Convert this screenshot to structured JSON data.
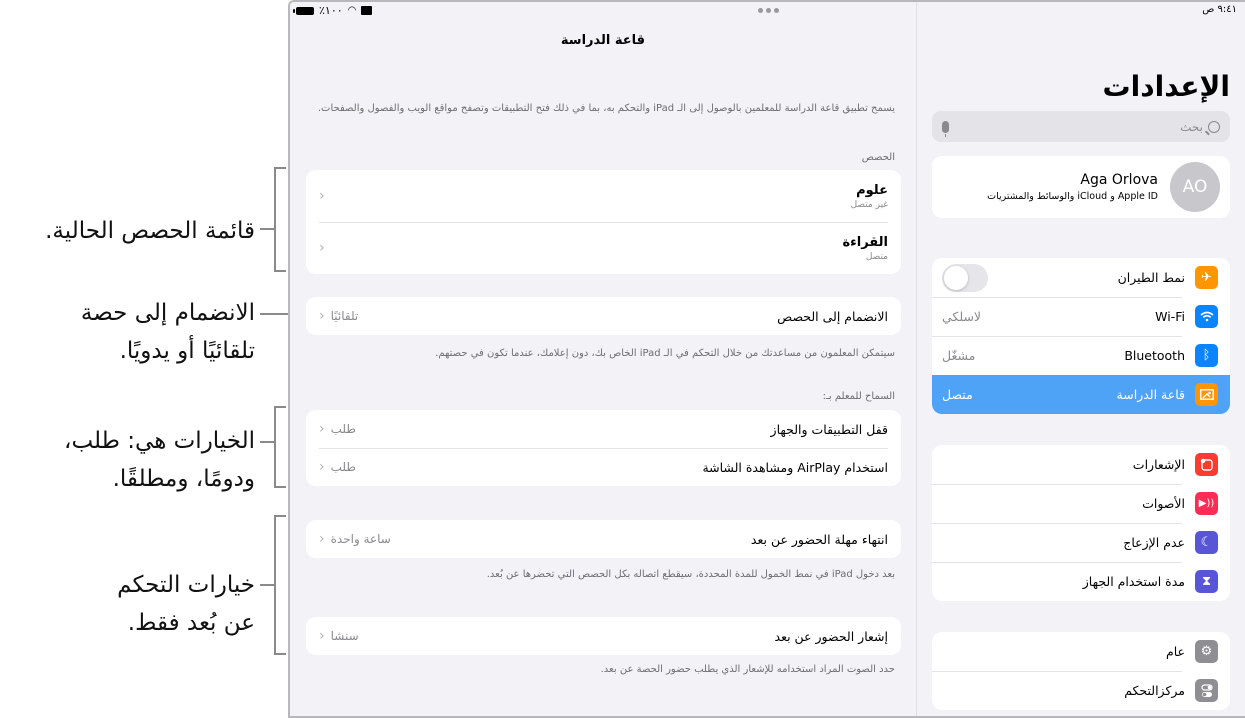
{
  "callouts": [
    {
      "lines": [
        "قائمة الحصص الحالية."
      ]
    },
    {
      "lines": [
        "الانضمام إلى حصة",
        "تلقائيًا أو يدويًا."
      ]
    },
    {
      "lines": [
        "الخيارات هي: طلب،",
        "ودومًا، ومطلقًا."
      ]
    },
    {
      "lines": [
        "خيارات التحكم",
        "عن بُعد فقط."
      ]
    }
  ],
  "status_bar": {
    "time": "٩:٤١ ص",
    "battery": "٪١٠٠"
  },
  "detail": {
    "title": "قاعة الدراسة",
    "intro": "يسمح تطبيق قاعة الدراسة للمعلمين بالوصول إلى الـ iPad والتحكم به، بما في ذلك فتح التطبيقات وتصفح مواقع الويب والفصول والصفحات.",
    "classes_header": "الحصص",
    "classes": [
      {
        "title": "علوم",
        "status": "غير متصل"
      },
      {
        "title": "القراءة",
        "status": "متصل"
      }
    ],
    "join": {
      "label": "الانضمام إلى الحصص",
      "value": "تلقائيًا"
    },
    "join_note": "سيتمكن المعلمون من مساعدتك من خلال التحكم في الـ iPad الخاص بك، دون إعلامك، عندما تكون في حصتهم.",
    "allow_header": "السماح للمعلم بـ:",
    "allow": [
      {
        "label": "قفل التطبيقات والجهاز",
        "value": "طلب"
      },
      {
        "label": "استخدام AirPlay ومشاهدة الشاشة",
        "value": "طلب"
      }
    ],
    "timeout": {
      "label": "انتهاء مهلة الحضور عن بعد",
      "value": "ساعة واحدة"
    },
    "timeout_note": "بعد دخول iPad في نمط الخمول للمدة المحددة، سيقطع اتصاله بكل الحصص التي تحضرها عن بُعد.",
    "notify": {
      "label": "إشعار الحضور عن بعد",
      "value": "سنشا"
    },
    "notify_note": "حدد الصوت المراد استخدامه للإشعار الذي يطلب حضور الحصة عن بعد."
  },
  "sidebar": {
    "title": "الإعدادات",
    "search_placeholder": "بحث",
    "profile": {
      "initials": "AO",
      "name": "Aga Orlova",
      "subtitle": "Apple ID و iCloud والوسائط والمشتريات"
    },
    "group1": [
      {
        "label": "نمط الطيران",
        "icon": "airplane-icon",
        "color": "#ff9500",
        "toggle": false
      },
      {
        "label": "Wi-Fi",
        "icon": "wifi-icon",
        "color": "#0a84ff",
        "value": "لاسلكي"
      },
      {
        "label": "Bluetooth",
        "icon": "bluetooth-icon",
        "color": "#0a84ff",
        "value": "مشغّل"
      },
      {
        "label": "قاعة الدراسة",
        "icon": "classroom-icon",
        "color": "#ff9500",
        "value": "متصل",
        "selected": true
      }
    ],
    "group2": [
      {
        "label": "الإشعارات",
        "icon": "notifications-icon",
        "color": "#ff3b30"
      },
      {
        "label": "الأصوات",
        "icon": "sounds-icon",
        "color": "#ff2d55"
      },
      {
        "label": "عدم الإزعاج",
        "icon": "moon-icon",
        "color": "#5856d6"
      },
      {
        "label": "مدة استخدام الجهاز",
        "icon": "hourglass-icon",
        "color": "#5856d6"
      }
    ],
    "group3": [
      {
        "label": "عام",
        "icon": "gear-icon",
        "color": "#8e8e93"
      },
      {
        "label": "مركزالتحكم",
        "icon": "control-center-icon",
        "color": "#8e8e93"
      }
    ]
  }
}
